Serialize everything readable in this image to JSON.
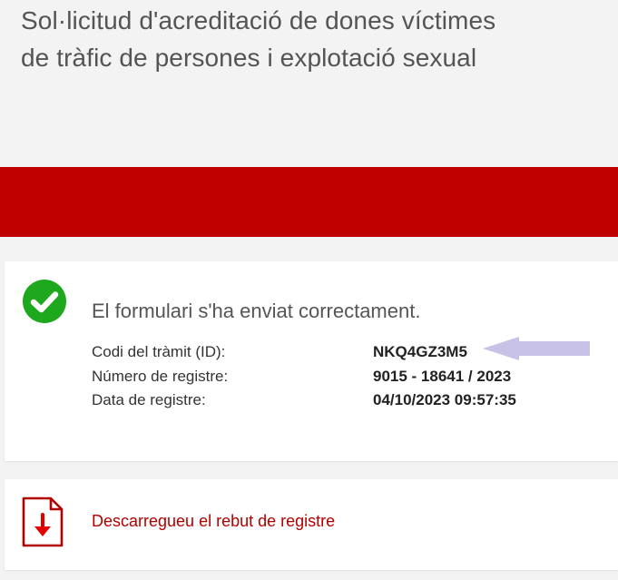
{
  "header": {
    "title": "Sol·licitud d'acreditació de dones víctimes de tràfic de persones i explotació sexual"
  },
  "colors": {
    "brand_red": "#c00000",
    "success_green": "#1da81d",
    "link_red": "#b30000",
    "annotation_arrow": "#c8c2e6"
  },
  "confirmation": {
    "icon": "check-circle-icon",
    "message": "El formulari s'ha enviat correctament.",
    "details": [
      {
        "label": "Codi del tràmit (ID):",
        "value": "NKQ4GZ3M5"
      },
      {
        "label": "Número de registre:",
        "value": "9015 - 18641 / 2023"
      },
      {
        "label": "Data de registre:",
        "value": "04/10/2023 09:57:35"
      }
    ]
  },
  "download": {
    "icon": "pdf-download-icon",
    "link_label": "Descarregueu el rebut de registre"
  }
}
